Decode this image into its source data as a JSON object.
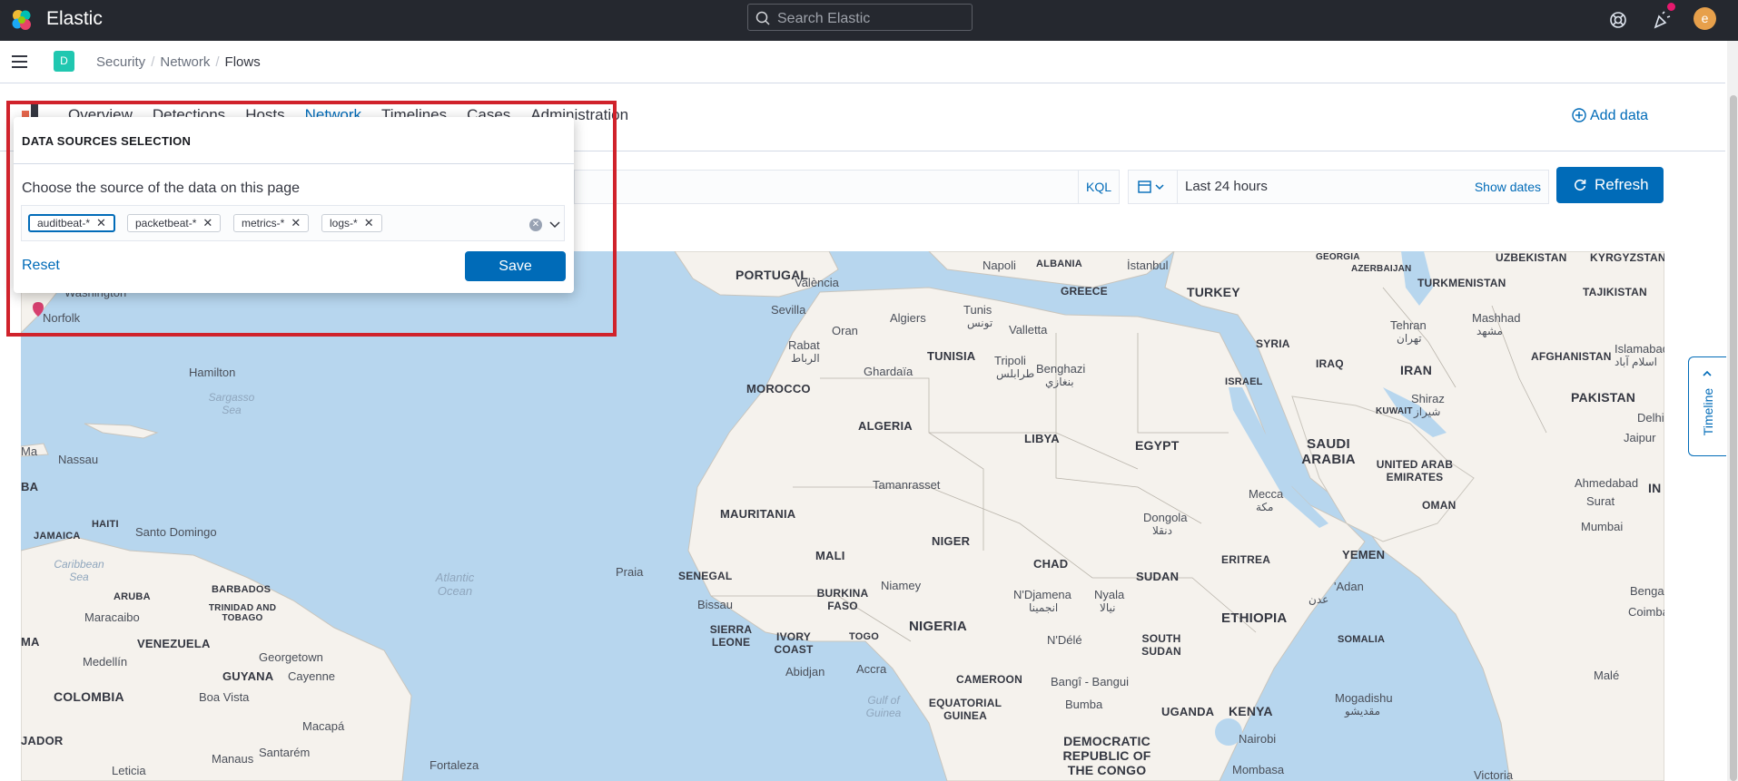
{
  "header": {
    "brand": "Elastic",
    "search_placeholder": "Search Elastic",
    "user_initial": "e"
  },
  "breadcrumbs": {
    "space_initial": "D",
    "items": [
      "Security",
      "Network",
      "Flows"
    ]
  },
  "app_nav": {
    "tabs": [
      "Overview",
      "Detections",
      "Hosts",
      "Network",
      "Timelines",
      "Cases",
      "Administration"
    ],
    "active_tab": "Network",
    "add_data_label": "Add data"
  },
  "query_bar": {
    "kql_label": "KQL",
    "date_range": "Last 24 hours",
    "show_dates_label": "Show dates",
    "refresh_label": "Refresh"
  },
  "data_sources_popover": {
    "title": "DATA SOURCES SELECTION",
    "description": "Choose the source of the data on this page",
    "selected_patterns": [
      "auditbeat-*",
      "packetbeat-*",
      "metrics-*",
      "logs-*"
    ],
    "reset_label": "Reset",
    "save_label": "Save"
  },
  "timeline": {
    "label": "Timeline"
  },
  "map": {
    "labels": {
      "washington": "Washington",
      "norfolk": "Norfolk",
      "hamilton": "Hamilton",
      "sargasso": "Sargasso Sea",
      "nassau": "Nassau",
      "haiti": "HAITI",
      "jamaica": "JAMAICA",
      "santo_domingo": "Santo Domingo",
      "caribbean": "Caribbean Sea",
      "aruba": "ARUBA",
      "barbados": "BARBADOS",
      "trinidad": "TRINIDAD AND TOBAGO",
      "maracaibo": "Maracaibo",
      "venezuela": "VENEZUELA",
      "medellin": "Medellín",
      "georgetown": "Georgetown",
      "guyana": "GUYANA",
      "cayenne": "Cayenne",
      "colombia": "COLOMBIA",
      "boa_vista": "Boa Vista",
      "macapa": "Macapá",
      "manaus": "Manaus",
      "santarem": "Santarém",
      "leticia": "Leticia",
      "fortaleza": "Fortaleza",
      "ecuador": "JADOR",
      "atlantic": "Atlantic Ocean",
      "praia": "Praia",
      "portugal": "PORTUGAL",
      "valencia": "València",
      "sevilla": "Sevilla",
      "oran": "Oran",
      "algiers": "Algiers",
      "tunis": "Tunis",
      "tunis_ar": "تونس",
      "rabat": "Rabat",
      "rabat_ar": "الرباط",
      "morocco": "MOROCCO",
      "ghardaia": "Ghardaïa",
      "tunisia": "TUNISIA",
      "tripoli": "Tripoli",
      "tripoli_ar": "طرابلس",
      "napoli": "Napoli",
      "albania": "ALBANIA",
      "greece": "GREECE",
      "valletta": "Valletta",
      "benghazi": "Benghazi",
      "benghazi_ar": "بنغازي",
      "algeria": "ALGERIA",
      "libya": "LIBYA",
      "tamanrasset": "Tamanrasset",
      "mauritania": "MAURITANIA",
      "mali": "MALI",
      "niger": "NIGER",
      "senegal": "SENEGAL",
      "bissau": "Bissau",
      "burkina": "BURKINA FASO",
      "niamey": "Niamey",
      "chad": "CHAD",
      "ndjamena": "N'Djamena",
      "ndjamena_ar": "انجمينا",
      "sierra_leone": "SIERRA LEONE",
      "ivory_coast": "IVORY COAST",
      "togo": "TOGO",
      "nigeria": "NIGERIA",
      "abidjan": "Abidjan",
      "accra": "Accra",
      "gulf_guinea": "Gulf of Guinea",
      "cameroon": "CAMEROON",
      "eq_guinea": "EQUATORIAL GUINEA",
      "bangui": "Bangî - Bangui",
      "bumba": "Bumba",
      "drc": "DEMOCRATIC REPUBLIC OF THE CONGO",
      "ndele": "N'Délé",
      "nyala": "Nyala",
      "nyala_ar": "نيالا",
      "sudan": "SUDAN",
      "south_sudan": "SOUTH SUDAN",
      "uganda": "UGANDA",
      "kenya": "KENYA",
      "nairobi": "Nairobi",
      "mombasa": "Mombasa",
      "egypt": "EGYPT",
      "dongola": "Dongola",
      "dongola_ar": "دنقلا",
      "eritrea": "ERITREA",
      "ethiopia": "ETHIOPIA",
      "mecca": "Mecca",
      "mecca_ar": "مكة",
      "yemen": "YEMEN",
      "adan": "'Adan",
      "adan_ar": "عدن",
      "somalia": "SOMALIA",
      "mogadishu": "Mogadishu",
      "mogadishu_ar": "مقديشو",
      "istanbul": "İstanbul",
      "turkey": "TURKEY",
      "syria": "SYRIA",
      "israel": "ISRAEL",
      "iraq": "IRAQ",
      "kuwait": "KUWAIT",
      "saudi": "SAUDI ARABIA",
      "uae": "UNITED ARAB EMIRATES",
      "oman": "OMAN",
      "georgia": "GEORGIA",
      "azerbaijan": "AZERBAIJAN",
      "turkmenistan": "TURKMENISTAN",
      "uzbekistan": "UZBEKISTAN",
      "kyrgyzstan": "KYRGYZSTAN",
      "tajikistan": "TAJIKISTAN",
      "tehran": "Tehran",
      "tehran_ar": "تهران",
      "mashhad": "Mashhad",
      "mashhad_ar": "مشهد",
      "iran": "IRAN",
      "afghanistan": "AFGHANISTAN",
      "islamabad": "Islamabad",
      "islamabad_ar": "اسلام آباد",
      "shiraz": "Shiraz",
      "shiraz_ar": "شیراز",
      "pakistan": "PAKISTAN",
      "delhi": "Delhi",
      "jaipur": "Jaipur",
      "ahmedabad": "Ahmedabad",
      "surat": "Surat",
      "india": "IN",
      "mumbai": "Mumbai",
      "bengaluru": "Benga",
      "coimbatore": "Coimbat",
      "male": "Malé",
      "victoria": "Victoria",
      "ma": "MA",
      "ba": "BA",
      "m": "Ma"
    }
  },
  "colors": {
    "topbar": "#25282f",
    "accent": "#006bb8",
    "highlight": "#d0222b",
    "water": "#b7d6ee",
    "land": "#f5f2ed"
  }
}
